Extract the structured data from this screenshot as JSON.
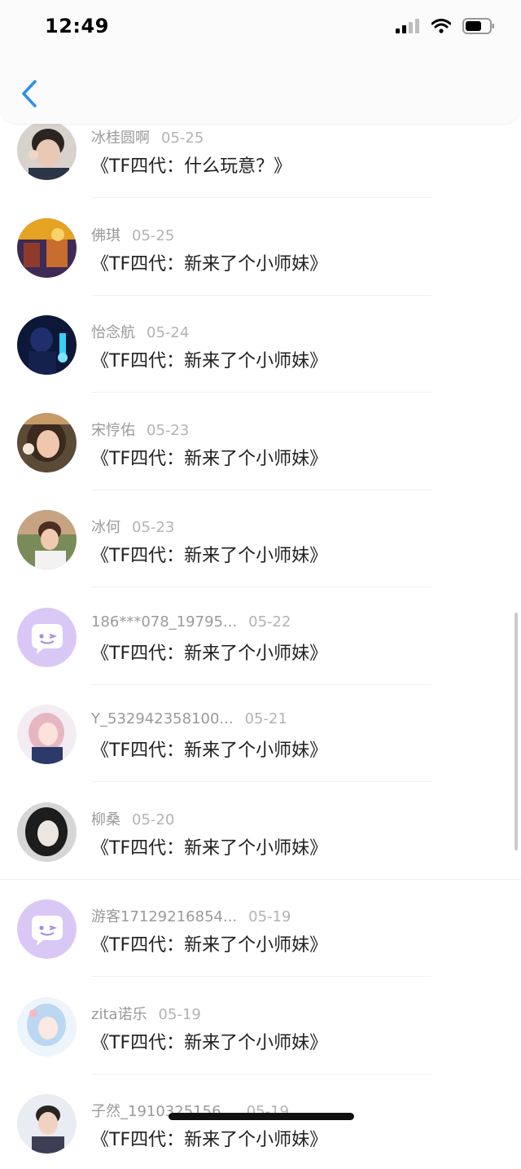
{
  "status_bar": {
    "time": "12:49"
  },
  "nav": {
    "back_icon": "chevron-left-icon",
    "accent_color": "#2a8ff0"
  },
  "items": [
    {
      "user": "冰桂圆啊",
      "date": "05-25",
      "title": "《TF四代：什么玩意？》",
      "avatar": "photo-boy-avatar"
    },
    {
      "user": "佛琪",
      "date": "05-25",
      "title": "《TF四代：新来了个小师妹》",
      "avatar": "game-art-avatar"
    },
    {
      "user": "怡念航",
      "date": "05-24",
      "title": "《TF四代：新来了个小师妹》",
      "avatar": "stage-photo-avatar"
    },
    {
      "user": "宋悙佑",
      "date": "05-23",
      "title": "《TF四代：新来了个小师妹》",
      "avatar": "girl-photo-avatar"
    },
    {
      "user": "冰何",
      "date": "05-23",
      "title": "《TF四代：新来了个小师妹》",
      "avatar": "boy-photo-avatar"
    },
    {
      "user": "186***078_19795...",
      "date": "05-22",
      "title": "《TF四代：新来了个小师妹》",
      "avatar": "default-chat-avatar"
    },
    {
      "user": "Y_532942358100...",
      "date": "05-21",
      "title": "《TF四代：新来了个小师妹》",
      "avatar": "anime-girl-avatar"
    },
    {
      "user": "柳桑",
      "date": "05-20",
      "title": "《TF四代：新来了个小师妹》",
      "avatar": "girl-bw-photo-avatar"
    },
    {
      "user": "游客17129216854...",
      "date": "05-19",
      "title": "《TF四代：新来了个小师妹》",
      "avatar": "default-chat-avatar"
    },
    {
      "user": "zita诺乐",
      "date": "05-19",
      "title": "《TF四代：新来了个小师妹》",
      "avatar": "anime-blue-avatar"
    },
    {
      "user": "子然_1910325156...",
      "date": "05-19",
      "title": "《TF四代：新来了个小师妹》",
      "avatar": "boy-photo-avatar"
    }
  ]
}
